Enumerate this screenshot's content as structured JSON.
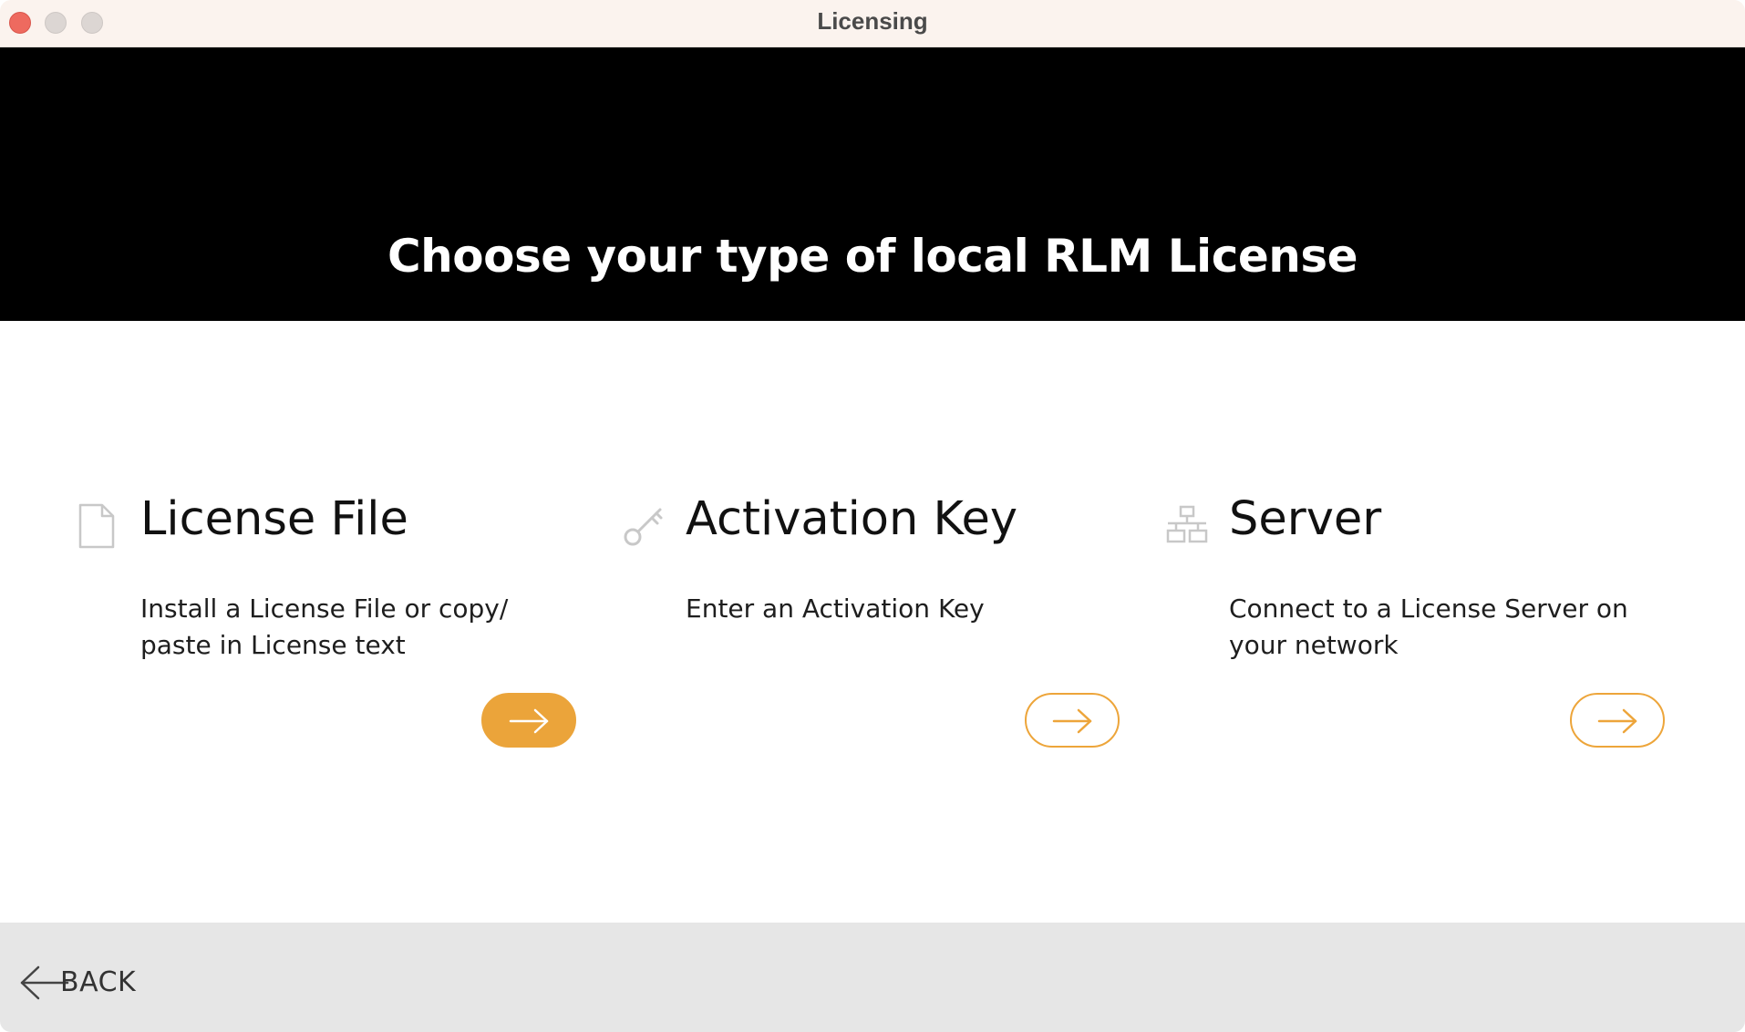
{
  "window": {
    "title": "Licensing"
  },
  "banner": {
    "title": "Choose your type of local RLM License"
  },
  "options": [
    {
      "icon": "document-icon",
      "title": "License File",
      "description": "Install a License File or copy/ paste in License text",
      "button_style": "filled"
    },
    {
      "icon": "key-icon",
      "title": "Activation Key",
      "description": "Enter an Activation Key",
      "button_style": "outline"
    },
    {
      "icon": "network-icon",
      "title": "Server",
      "description": "Connect to a License Server on your network",
      "button_style": "outline"
    }
  ],
  "footer": {
    "back_label": "BACK"
  },
  "colors": {
    "accent": "#eba43a",
    "banner_bg": "#000000",
    "footer_bg": "#e6e6e6",
    "titlebar_bg": "#fbf3ee"
  }
}
